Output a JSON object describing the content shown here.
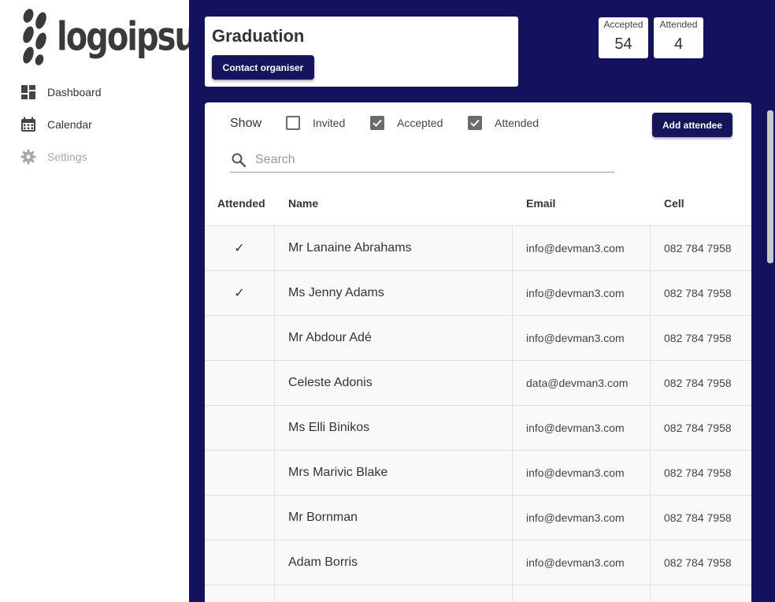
{
  "brand": {
    "logo_text": "logoipsum"
  },
  "sidebar": {
    "items": [
      {
        "label": "Dashboard",
        "icon": "dashboard-icon",
        "disabled": false
      },
      {
        "label": "Calendar",
        "icon": "calendar-icon",
        "disabled": false
      },
      {
        "label": "Settings",
        "icon": "gear-icon",
        "disabled": true
      }
    ]
  },
  "event": {
    "title": "Graduation",
    "contact_label": "Contact organiser"
  },
  "stats": {
    "accepted_label": "Accepted",
    "accepted_value": "54",
    "attended_label": "Attended",
    "attended_value": "4"
  },
  "filters": {
    "show_label": "Show",
    "invited_label": "Invited",
    "invited_checked": false,
    "accepted_label": "Accepted",
    "accepted_checked": true,
    "attended_label": "Attended",
    "attended_checked": true
  },
  "add_attendee_label": "Add attendee",
  "search": {
    "placeholder": "Search",
    "value": ""
  },
  "table": {
    "columns": [
      "Attended",
      "Name",
      "Email",
      "Cell"
    ],
    "rows": [
      {
        "attended": "✓",
        "name": "Mr Lanaine Abrahams",
        "email": "info@devman3.com",
        "cell": "082 784 7958"
      },
      {
        "attended": "✓",
        "name": "Ms Jenny Adams",
        "email": "info@devman3.com",
        "cell": "082 784 7958"
      },
      {
        "attended": "",
        "name": "Mr Abdour Adé",
        "email": "info@devman3.com",
        "cell": "082 784 7958"
      },
      {
        "attended": "",
        "name": "Celeste Adonis",
        "email": "data@devman3.com",
        "cell": "082 784 7958"
      },
      {
        "attended": "",
        "name": "Ms Elli Binikos",
        "email": "info@devman3.com",
        "cell": "082 784 7958"
      },
      {
        "attended": "",
        "name": "Mrs Marivic Blake",
        "email": "info@devman3.com",
        "cell": "082 784 7958"
      },
      {
        "attended": "",
        "name": "Mr Bornman",
        "email": "info@devman3.com",
        "cell": "082 784 7958"
      },
      {
        "attended": "",
        "name": "Adam Borris",
        "email": "info@devman3.com",
        "cell": "082 784 7958"
      },
      {
        "attended": "",
        "name": "",
        "email": "",
        "cell": ""
      }
    ]
  },
  "colors": {
    "primary": "#16145c",
    "background": "#14125e",
    "row_background": "#f9f9f9"
  }
}
